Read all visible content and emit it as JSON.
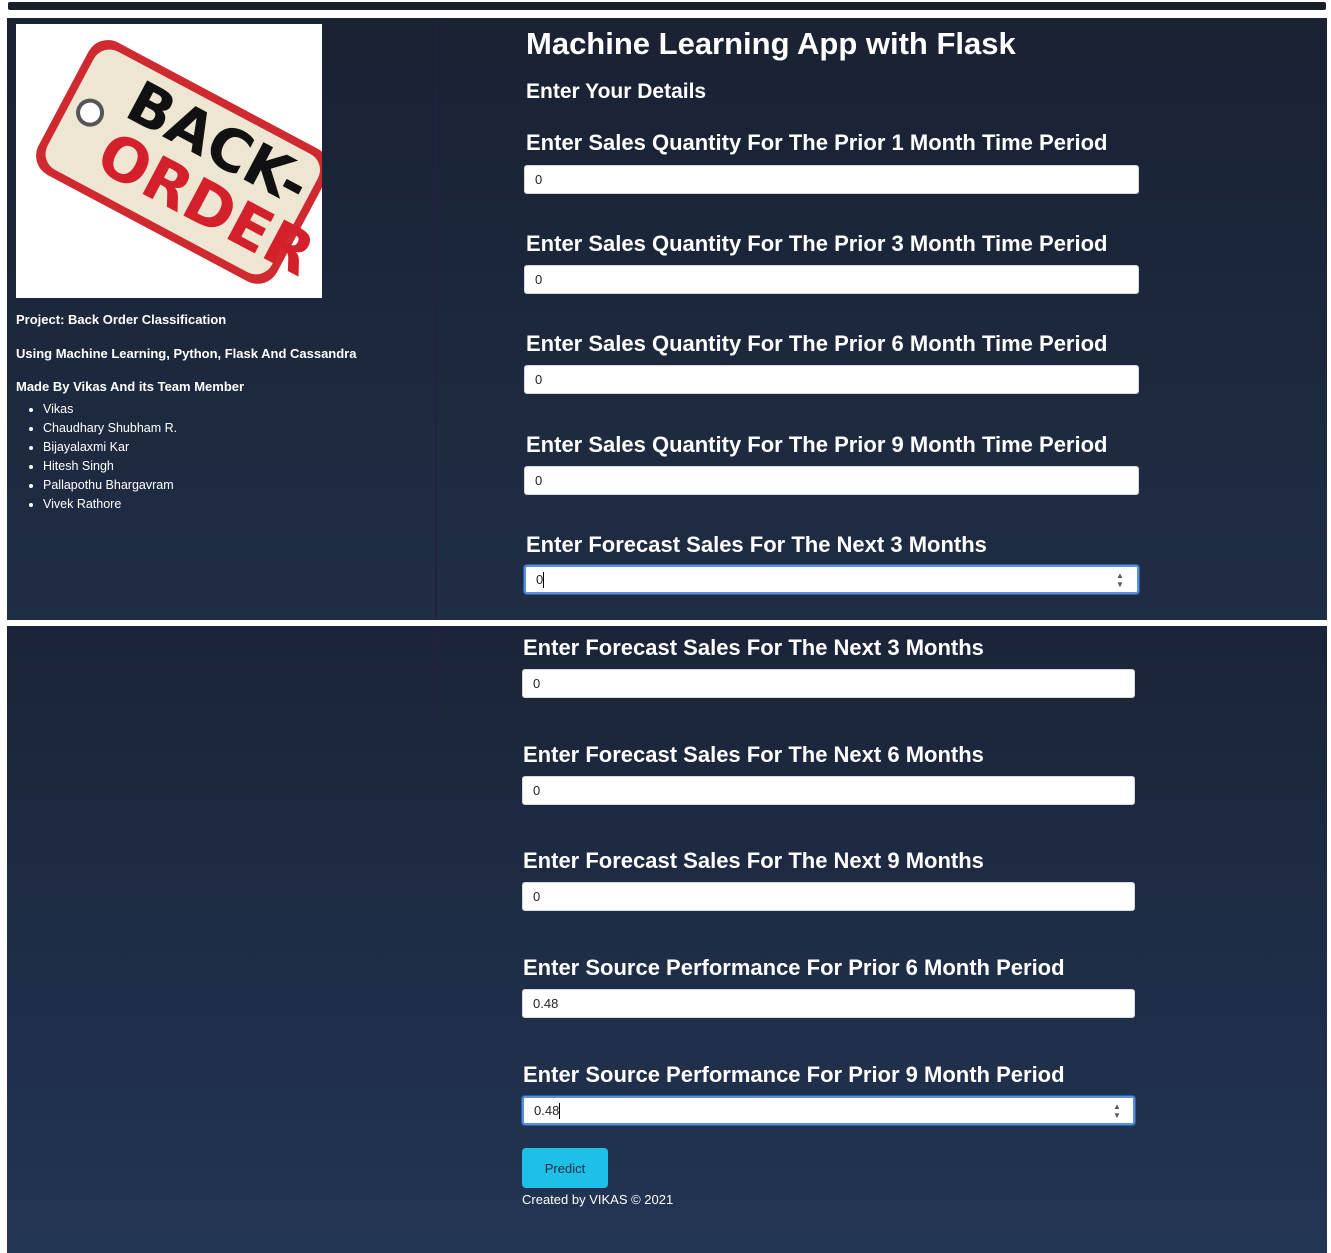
{
  "sidebar": {
    "logo_line1": "BACK-",
    "logo_line2": "ORDER",
    "project": "Project: Back Order Classification",
    "using": "Using Machine Learning, Python, Flask And Cassandra",
    "made_by": "Made By Vikas And its Team Member",
    "members": [
      "Vikas",
      "Chaudhary Shubham R.",
      "Bijayalaxmi Kar",
      "Hitesh Singh",
      "Pallapothu Bhargavram",
      "Vivek Rathore"
    ]
  },
  "main": {
    "title": "Machine Learning App with Flask",
    "subtitle": "Enter Your Details"
  },
  "top_fields": [
    {
      "label": "Enter Sales Quantity For The Prior 1 Month Time Period",
      "value": "0"
    },
    {
      "label": "Enter Sales Quantity For The Prior 3 Month Time Period",
      "value": "0"
    },
    {
      "label": "Enter Sales Quantity For The Prior 6 Month Time Period",
      "value": "0"
    },
    {
      "label": "Enter Sales Quantity For The Prior 9 Month Time Period",
      "value": "0"
    },
    {
      "label": "Enter Forecast Sales For The Next 3 Months",
      "value": "0"
    }
  ],
  "bottom_fields": [
    {
      "label": "Enter Forecast Sales For The Next 3 Months",
      "value": "0"
    },
    {
      "label": "Enter Forecast Sales For The Next 6 Months",
      "value": "0"
    },
    {
      "label": "Enter Forecast Sales For The Next 9 Months",
      "value": "0"
    },
    {
      "label": "Enter Source Performance For Prior 6 Month Period",
      "value": "0.48"
    },
    {
      "label": "Enter Source Performance For Prior 9 Month Period",
      "value": "0.48"
    }
  ],
  "predict_label": "Predict",
  "footer": "Created by VIKAS © 2021",
  "colors": {
    "background": "#1f2d45",
    "button": "#1ec0e8",
    "tag_red": "#d4202a"
  }
}
